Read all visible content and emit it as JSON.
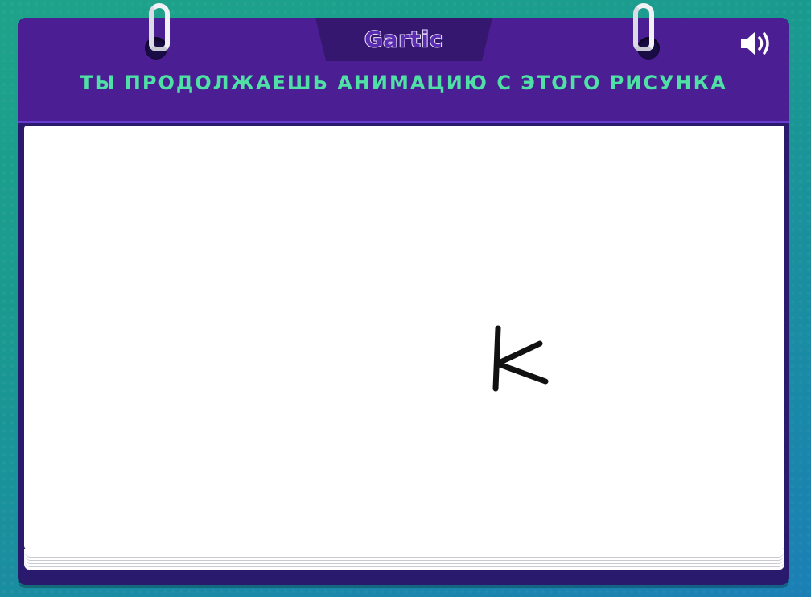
{
  "game": {
    "logo": "Gartic",
    "title": "ТЫ ПРОДОЛЖАЕШЬ АНИМАЦИЮ С ЭТОГО РИСУНКА"
  },
  "icons": {
    "sound": "speaker-volume-icon",
    "rings": "binder-ring-icon"
  },
  "colors": {
    "background_start": "#1ea38a",
    "background_end": "#1b7fb5",
    "header": "#4b1e93",
    "panel": "#2a1a6e",
    "title_text": "#4fe0a5",
    "canvas": "#ffffff",
    "stroke": "#111111"
  },
  "drawing": {
    "description_glyph": "K"
  }
}
